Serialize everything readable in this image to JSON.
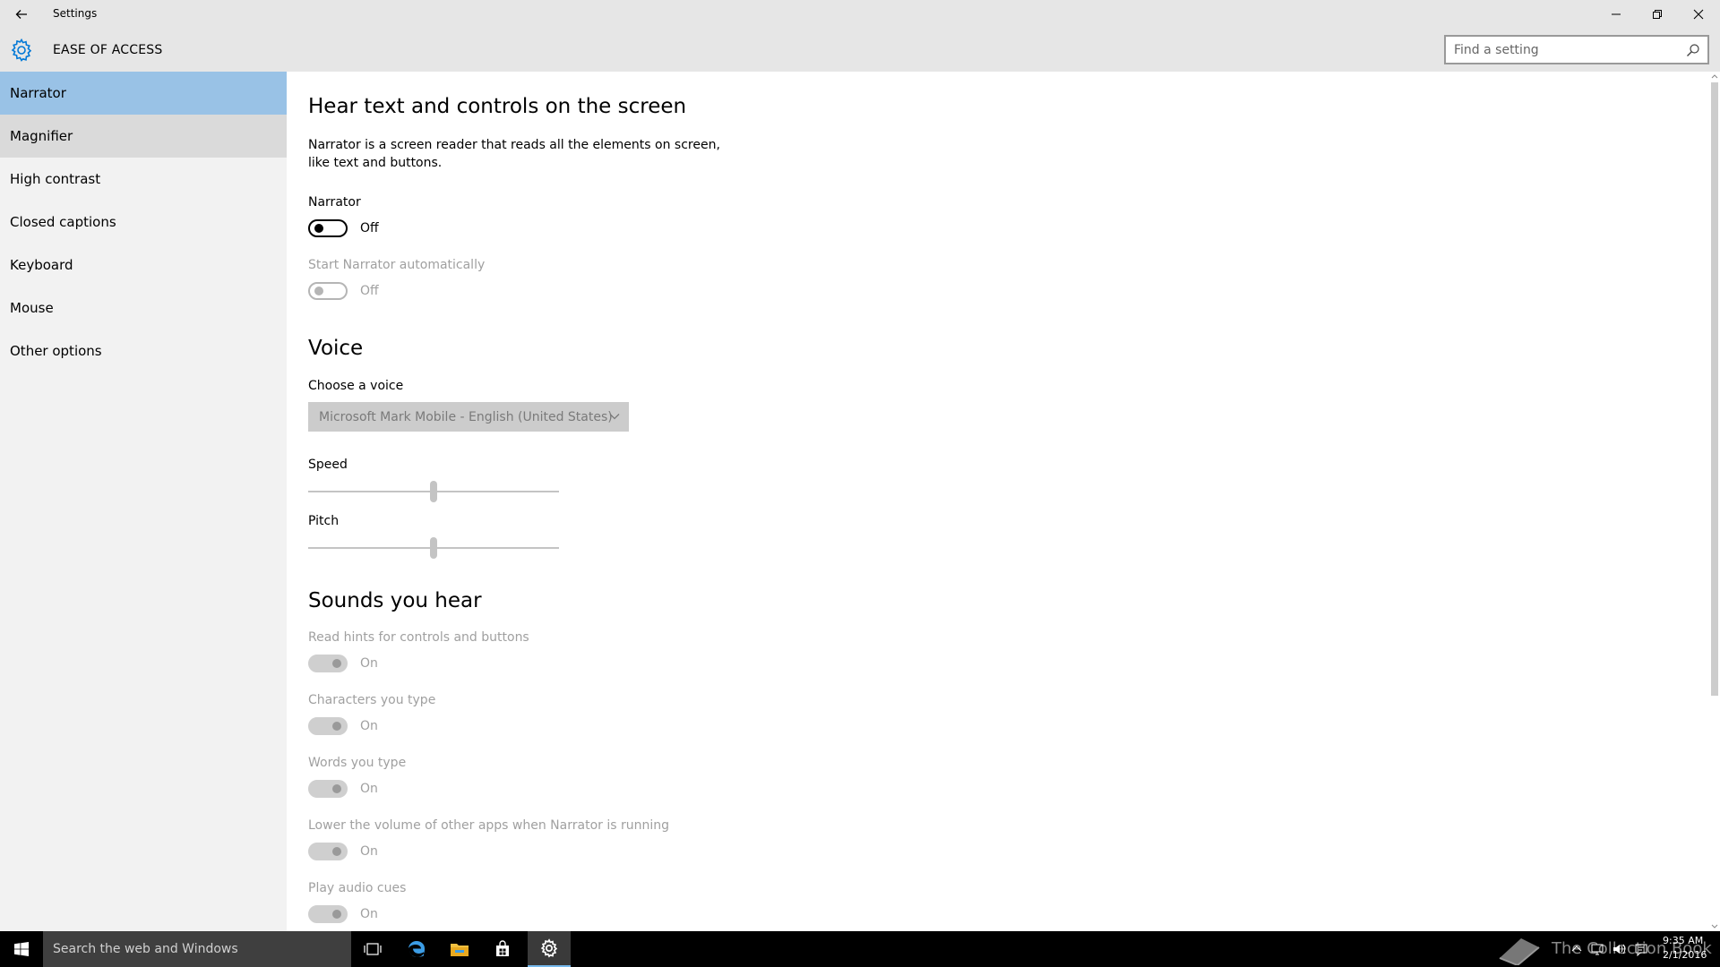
{
  "window": {
    "title": "Settings"
  },
  "header": {
    "section_title": "EASE OF ACCESS",
    "search_placeholder": "Find a setting"
  },
  "sidebar": {
    "items": [
      {
        "label": "Narrator",
        "state": "selected"
      },
      {
        "label": "Magnifier",
        "state": "hover"
      },
      {
        "label": "High contrast",
        "state": "normal"
      },
      {
        "label": "Closed captions",
        "state": "normal"
      },
      {
        "label": "Keyboard",
        "state": "normal"
      },
      {
        "label": "Mouse",
        "state": "normal"
      },
      {
        "label": "Other options",
        "state": "normal"
      }
    ]
  },
  "main": {
    "heading": "Hear text and controls on the screen",
    "description": "Narrator is a screen reader that reads all the elements on screen, like text and buttons.",
    "narrator": {
      "label": "Narrator",
      "state": "Off"
    },
    "start_auto": {
      "label": "Start Narrator automatically",
      "state": "Off"
    },
    "voice": {
      "heading": "Voice",
      "choose_label": "Choose a voice",
      "selected_voice": "Microsoft Mark Mobile - English (United States)",
      "speed_label": "Speed",
      "speed_value": 0.5,
      "pitch_label": "Pitch",
      "pitch_value": 0.5
    },
    "sounds": {
      "heading": "Sounds you hear",
      "items": [
        {
          "label": "Read hints for controls and buttons",
          "state": "On"
        },
        {
          "label": "Characters you type",
          "state": "On"
        },
        {
          "label": "Words you type",
          "state": "On"
        },
        {
          "label": "Lower the volume of other apps when Narrator is running",
          "state": "On"
        },
        {
          "label": "Play audio cues",
          "state": "On"
        }
      ]
    }
  },
  "taskbar": {
    "search_placeholder": "Search the web and Windows",
    "watermark": "The Collection Book",
    "time": "9:35 AM",
    "date": "2/1/2016"
  },
  "colors": {
    "accent": "#0078d7",
    "sidebar_selected": "#99c2e6",
    "sidebar_hover": "#dadada",
    "chrome": "#e6e6e6"
  },
  "icons": {
    "back": "back-arrow-icon",
    "header": "gear-icon",
    "search": "search-icon",
    "window_controls": [
      "minimize-icon",
      "restore-icon",
      "close-icon"
    ],
    "taskbar": [
      "windows-logo-icon",
      "task-view-icon",
      "edge-icon",
      "file-explorer-icon",
      "store-icon",
      "settings-gear-icon"
    ],
    "tray": [
      "book-icon",
      "chevron-up-icon",
      "network-icon",
      "volume-icon",
      "action-center-icon"
    ]
  }
}
